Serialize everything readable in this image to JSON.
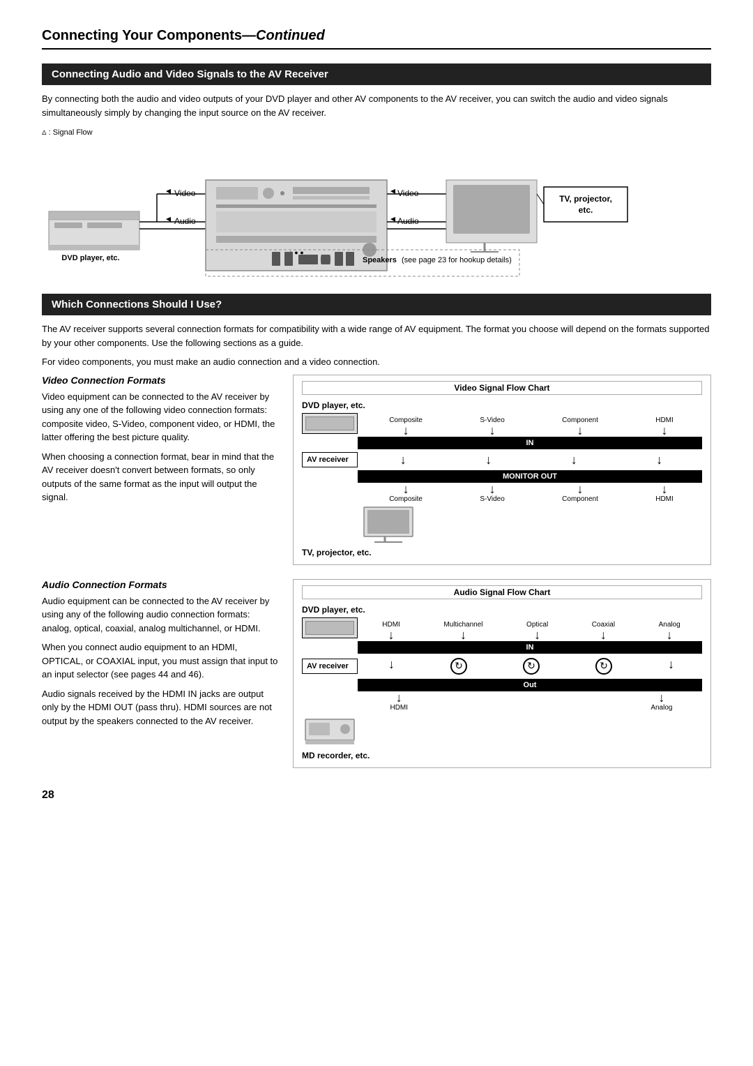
{
  "page": {
    "title": "Connecting Your Components",
    "title_continued": "—Continued",
    "page_number": "28"
  },
  "section1": {
    "header": "Connecting Audio and Video Signals to the AV Receiver",
    "body": "By connecting both the audio and video outputs of your DVD player and other AV components to the AV receiver, you can switch the audio and video signals simultaneously simply by changing the input source on the AV receiver.",
    "signal_flow_label": ": Signal Flow",
    "video_label": "Video",
    "audio_label": "Audio",
    "dvd_label": "DVD player, etc.",
    "speakers_label": "Speakers (see page 23 for hookup details)",
    "tv_label": "TV, projector, etc."
  },
  "section2": {
    "header": "Which Connections Should I Use?",
    "body1": "The AV receiver supports several connection formats for compatibility with a wide range of AV equipment. The format you choose will depend on the formats supported by your other components. Use the following sections as a guide.",
    "body2": "For video components, you must make an audio connection and a video connection.",
    "video_subsection": {
      "title": "Video Connection Formats",
      "body1": "Video equipment can be connected to the AV receiver by using any one of the following video connection formats: composite video, S-Video, component video, or HDMI, the latter offering the best picture quality.",
      "body2": "When choosing a connection format, bear in mind that the AV receiver doesn't convert between formats, so only outputs of the same format as the input will output the signal.",
      "chart_title": "Video Signal Flow Chart",
      "dvd_label": "DVD player, etc.",
      "labels_top": [
        "Composite",
        "S-Video",
        "Component",
        "HDMI"
      ],
      "in_label": "IN",
      "av_receiver_label": "AV receiver",
      "monitor_out_label": "MONITOR OUT",
      "labels_bottom": [
        "Composite",
        "S-Video",
        "Component",
        "HDMI"
      ],
      "tv_label": "TV, projector, etc."
    },
    "audio_subsection": {
      "title": "Audio Connection Formats",
      "body1": "Audio equipment can be connected to the AV receiver by using any of the following audio connection formats: analog, optical, coaxial, analog multichannel, or HDMI.",
      "body2": "When you connect audio equipment to an HDMI, OPTICAL, or COAXIAL input, you must assign that input to an input selector (see pages 44 and 46).",
      "body3": "Audio signals received by the HDMI IN jacks are output only by the HDMI OUT (pass thru). HDMI sources are not output by the speakers connected to the AV receiver.",
      "chart_title": "Audio Signal Flow Chart",
      "dvd_label": "DVD player, etc.",
      "labels_top": [
        "HDMI",
        "Multichannel",
        "Optical",
        "Coaxial",
        "Analog"
      ],
      "in_label": "IN",
      "av_receiver_label": "AV receiver",
      "out_label": "Out",
      "labels_bottom": [
        "HDMI",
        "",
        "",
        "",
        "Analog"
      ],
      "md_label": "MD recorder, etc."
    }
  }
}
